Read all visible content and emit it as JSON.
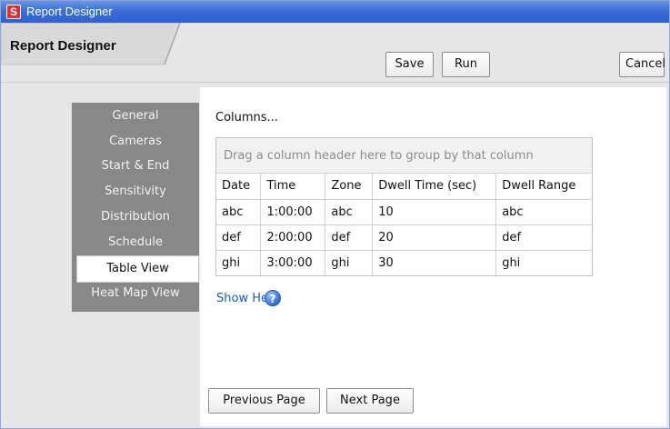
{
  "window": {
    "title": "Report Designer",
    "app_icon_glyph": "S",
    "app_icon_name": "app-logo-icon"
  },
  "toolbar": {
    "tab_label": "Report Designer",
    "save_label": "Save",
    "run_label": "Run",
    "cancel_label": "Cancel"
  },
  "nav": {
    "items": [
      {
        "label": "General",
        "selected": false
      },
      {
        "label": "Cameras",
        "selected": false
      },
      {
        "label": "Start & End",
        "selected": false
      },
      {
        "label": "Sensitivity",
        "selected": false
      },
      {
        "label": "Distribution",
        "selected": false
      },
      {
        "label": "Schedule",
        "selected": false
      },
      {
        "label": "Table View",
        "selected": true
      },
      {
        "label": "Heat Map View",
        "selected": false
      }
    ]
  },
  "main": {
    "columns_label": "Columns...",
    "group_placeholder": "Drag a column header here to group by that column",
    "table": {
      "headers": [
        "Date",
        "Time",
        "Zone",
        "Dwell Time (sec)",
        "Dwell Range"
      ],
      "rows": [
        [
          "abc",
          "1:00:00",
          "abc",
          "10",
          "abc"
        ],
        [
          "def",
          "2:00:00",
          "def",
          "20",
          "def"
        ],
        [
          "ghi",
          "3:00:00",
          "ghi",
          "30",
          "ghi"
        ]
      ]
    },
    "show_help_label": "Show Help",
    "help_icon_glyph": "?",
    "prev_label": "Previous Page",
    "next_label": "Next Page"
  },
  "colors": {
    "titlebar": "#3a6fd6",
    "nav_bg": "#888888",
    "link": "#1a5bb5"
  }
}
